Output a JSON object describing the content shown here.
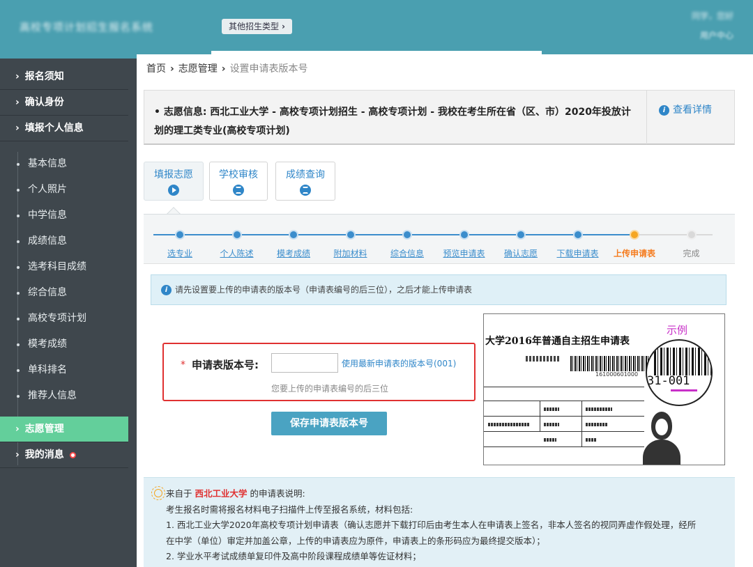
{
  "header": {
    "logo_text": "高校专项计划招生报名系统",
    "type_button": "其他招生类型",
    "user_name": "同学，您好",
    "user_center": "用户中心"
  },
  "sidebar": {
    "main": [
      "报名须知",
      "确认身份",
      "填报个人信息"
    ],
    "sub": [
      "基本信息",
      "个人照片",
      "中学信息",
      "成绩信息",
      "选考科目成绩",
      "综合信息",
      "高校专项计划",
      "模考成绩",
      "单科排名",
      "推荐人信息"
    ],
    "bottom": [
      "志愿管理",
      "我的消息"
    ],
    "active": "志愿管理"
  },
  "breadcrumb": [
    "首页",
    "志愿管理",
    "设置申请表版本号"
  ],
  "info": {
    "text": "• 志愿信息:  西北工业大学 - 高校专项计划招生 - 高校专项计划 - 我校在考生所在省（区、市）2020年投放计划的理工类专业(高校专项计划)",
    "detail_link": "查看详情"
  },
  "tabs": [
    "填报志愿",
    "学校审核",
    "成绩查询"
  ],
  "steps": {
    "labels": [
      "选专业",
      "个人陈述",
      "模考成绩",
      "附加材料",
      "综合信息",
      "预览申请表",
      "确认志愿",
      "下载申请表",
      "上传申请表",
      "完成"
    ],
    "current_index": 8
  },
  "notice": "请先设置要上传的申请表的版本号（申请表编号的后三位），之后才能上传申请表",
  "form": {
    "label": "申请表版本号:",
    "value": "",
    "use_latest": "使用最新申请表的版本号(001)",
    "hint": "您要上传的申请表编号的后三位",
    "save_button": "保存申请表版本号"
  },
  "sample": {
    "title": "大学2016年普通自主招生申请表",
    "tag": "示例",
    "zoom_number": "31-001",
    "small_number": "161000601000"
  },
  "description": {
    "prefix": "来自于",
    "school": "西北工业大学",
    "suffix": "的申请表说明:",
    "lines": [
      "考生报名时需将报名材料电子扫描件上传至报名系统，材料包括:",
      "1. 西北工业大学2020年高校专项计划申请表（确认志愿并下载打印后由考生本人在申请表上签名，非本人签名的视同弄虚作假处理，经所",
      "在中学（单位）审定并加盖公章，上传的申请表应为原件，申请表上的条形码应为最终提交版本）；",
      "2. 学业水平考试成绩单复印件及高中阶段课程成绩单等佐证材料；"
    ]
  },
  "colors": {
    "header": "#4a9fb0",
    "sidebar": "#3f474d",
    "active": "#63cf9b",
    "accent": "#2f86c8",
    "current_step": "#f5a623",
    "highlight": "#e03131"
  }
}
